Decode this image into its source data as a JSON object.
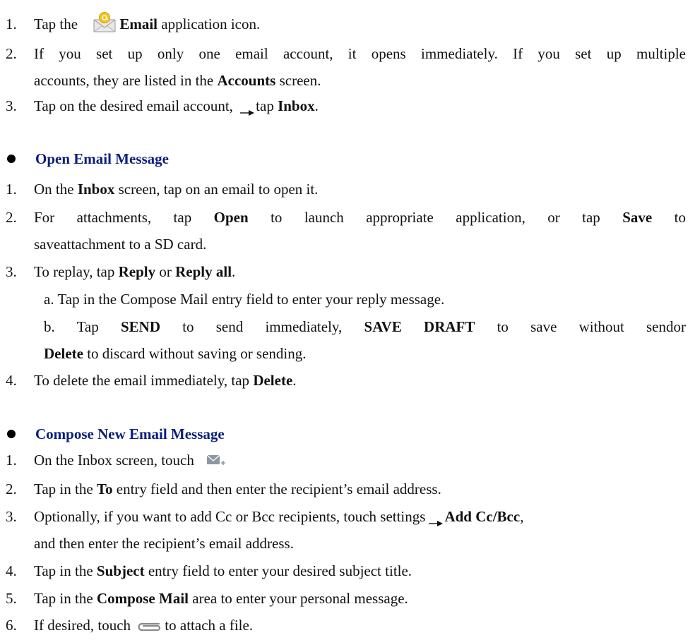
{
  "colors": {
    "heading": "#0a1f7c",
    "text": "#111111",
    "bullet": "#000000"
  },
  "intro": {
    "item1": {
      "num": "1.",
      "pre": "Tap the",
      "bold": "Email",
      "post": " application icon."
    },
    "item2": {
      "num": "2.",
      "line1": "If you set up only one email account, it opens immediately. If you set up multiple",
      "line2_pre": "accounts, they are listed in the ",
      "line2_bold": "Accounts",
      "line2_post": " screen."
    },
    "item3": {
      "num": "3.",
      "pre": "Tap on the desired email account, ",
      "mid": "tap ",
      "bold": "Inbox",
      "post": "."
    }
  },
  "open_section": {
    "heading": "Open Email Message",
    "item1": {
      "num": "1.",
      "pre": "On the ",
      "bold": "Inbox",
      "post": " screen, tap on an email to open it."
    },
    "item2": {
      "num": "2.",
      "pre": "For attachments, tap ",
      "bold1": "Open",
      "mid": " to launch appropriate application, or tap ",
      "bold2": "Save",
      "post": " to",
      "line2": "saveattachment to a SD card."
    },
    "item3": {
      "num": "3.",
      "pre": "To replay, tap ",
      "bold1": "Reply",
      "mid": " or ",
      "bold2": "Reply all",
      "post": "."
    },
    "item3a": "a. Tap in the Compose Mail entry field to enter your reply message.",
    "item3b": {
      "pre": "b. Tap ",
      "bold1": "SEND",
      "mid1": " to send immediately, ",
      "bold2": "SAVE DRAFT",
      "mid2": " to save without sendor",
      "line2_bold": "Delete",
      "line2_post": " to discard without saving or sending."
    },
    "item4": {
      "num": "4.",
      "pre": "To delete the email immediately, tap ",
      "bold": "Delete",
      "post": "."
    }
  },
  "compose_section": {
    "heading": "Compose New Email Message",
    "item1": {
      "num": "1.",
      "text": "On the Inbox screen, touch"
    },
    "item2": {
      "num": "2.",
      "pre": "Tap in the ",
      "bold": "To",
      "post": " entry field and then enter the recipient’s email address."
    },
    "item3": {
      "num": "3.",
      "pre": "Optionally, if you want to add Cc or Bcc recipients, touch settings",
      "bold": "Add Cc/Bcc",
      "post": ",",
      "line2": "and then enter the recipient’s email address."
    },
    "item4": {
      "num": "4.",
      "pre": "Tap in the ",
      "bold": "Subject",
      "post": " entry field to enter your desired subject title."
    },
    "item5": {
      "num": "5.",
      "pre": "Tap in the ",
      "bold": "Compose Mail",
      "post": " area to enter your personal message."
    },
    "item6": {
      "num": "6.",
      "pre": "If desired, touch ",
      "post": "to attach a file."
    }
  },
  "icons": {
    "email_app": "email-app-icon",
    "compose": "compose-mail-icon",
    "paperclip": "paperclip-icon",
    "arrow": "right-arrow-icon"
  }
}
